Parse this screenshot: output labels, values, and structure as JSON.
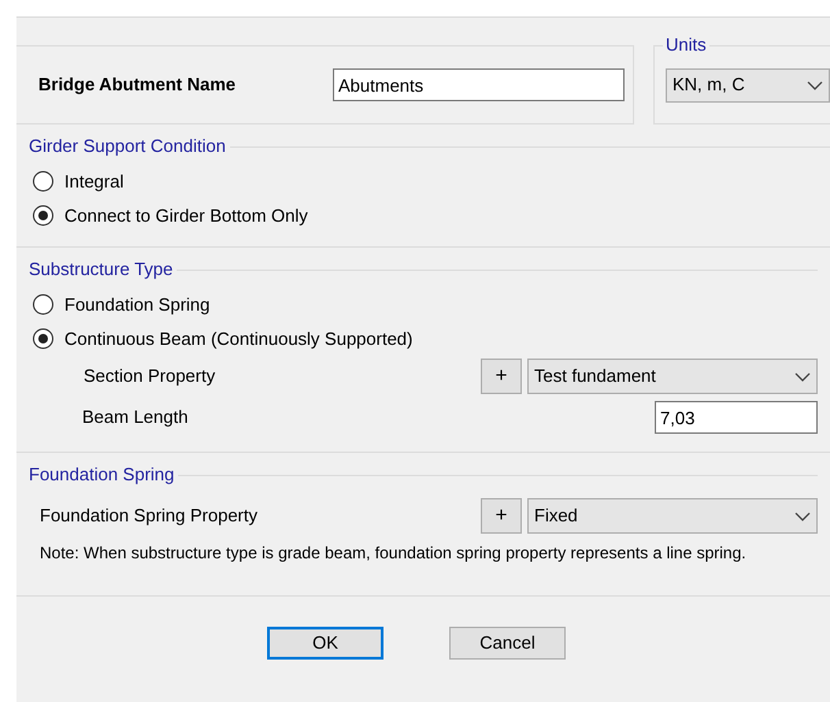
{
  "name_field": {
    "label": "Bridge Abutment Name",
    "value": "Abutments"
  },
  "units": {
    "title": "Units",
    "value": "KN, m, C"
  },
  "girder_support": {
    "title": "Girder Support Condition",
    "options": [
      {
        "label": "Integral",
        "selected": false
      },
      {
        "label": "Connect to Girder Bottom Only",
        "selected": true
      }
    ]
  },
  "substructure": {
    "title": "Substructure Type",
    "options": [
      {
        "label": "Foundation Spring",
        "selected": false
      },
      {
        "label": "Continuous Beam (Continuously Supported)",
        "selected": true
      }
    ],
    "section_property": {
      "label": "Section Property",
      "add": "+",
      "value": "Test fundament"
    },
    "beam_length": {
      "label": "Beam Length",
      "value": "7,03"
    }
  },
  "foundation_spring": {
    "title": "Foundation Spring",
    "property": {
      "label": "Foundation Spring Property",
      "add": "+",
      "value": "Fixed"
    },
    "note": "Note:  When substructure type is grade beam, foundation spring property represents a line spring."
  },
  "buttons": [
    {
      "label": "OK",
      "default": true
    },
    {
      "label": "Cancel",
      "default": false
    }
  ]
}
